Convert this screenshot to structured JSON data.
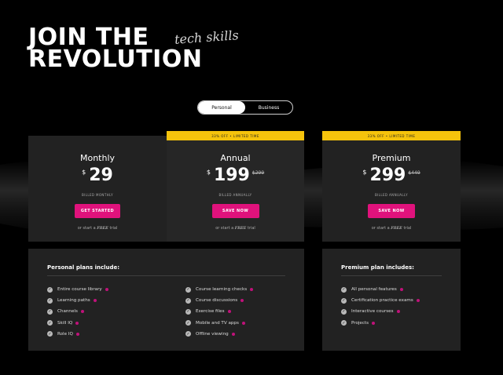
{
  "hero": {
    "line1": "JOIN THE",
    "line2": "REVOLUTION",
    "script": "tech skills"
  },
  "toggle": {
    "options": [
      "Personal",
      "Business"
    ],
    "selected": "Personal"
  },
  "plans": [
    {
      "name": "Monthly",
      "currency": "$",
      "price": "29",
      "old_price": "",
      "billing": "BILLED MONTHLY",
      "cta": "GET STARTED",
      "ribbon": "",
      "trial_prefix": "or start a",
      "trial_free": "FREE",
      "trial_suffix": "trial"
    },
    {
      "name": "Annual",
      "currency": "$",
      "price": "199",
      "old_price": "$299",
      "billing": "BILLED ANNUALLY",
      "cta": "SAVE NOW",
      "ribbon": "33% OFF • LIMITED TIME",
      "trial_prefix": "or start a",
      "trial_free": "FREE",
      "trial_suffix": "trial"
    },
    {
      "name": "Premium",
      "currency": "$",
      "price": "299",
      "old_price": "$449",
      "billing": "BILLED ANNUALLY",
      "cta": "SAVE NOW",
      "ribbon": "33% OFF • LIMITED TIME",
      "trial_prefix": "or start a",
      "trial_free": "FREE",
      "trial_suffix": "trial"
    }
  ],
  "personal_panel": {
    "title": "Personal plans include:",
    "col1": [
      "Entire course library",
      "Learning paths",
      "Channels",
      "Skill IQ",
      "Role IQ"
    ],
    "col2": [
      "Course learning checks",
      "Course discussions",
      "Exercise files",
      "Mobile and TV apps",
      "Offline viewing"
    ]
  },
  "premium_panel": {
    "title": "Premium plan includes:",
    "items": [
      "All personal features",
      "Certification practice exams",
      "Interactive courses",
      "Projects"
    ]
  },
  "colors": {
    "background": "#000000",
    "card": "#222222",
    "cta": "#e0127c",
    "ribbon": "#f5c30c",
    "info_dot": "#c0127a"
  },
  "icons": [
    "check-icon",
    "info-icon"
  ]
}
